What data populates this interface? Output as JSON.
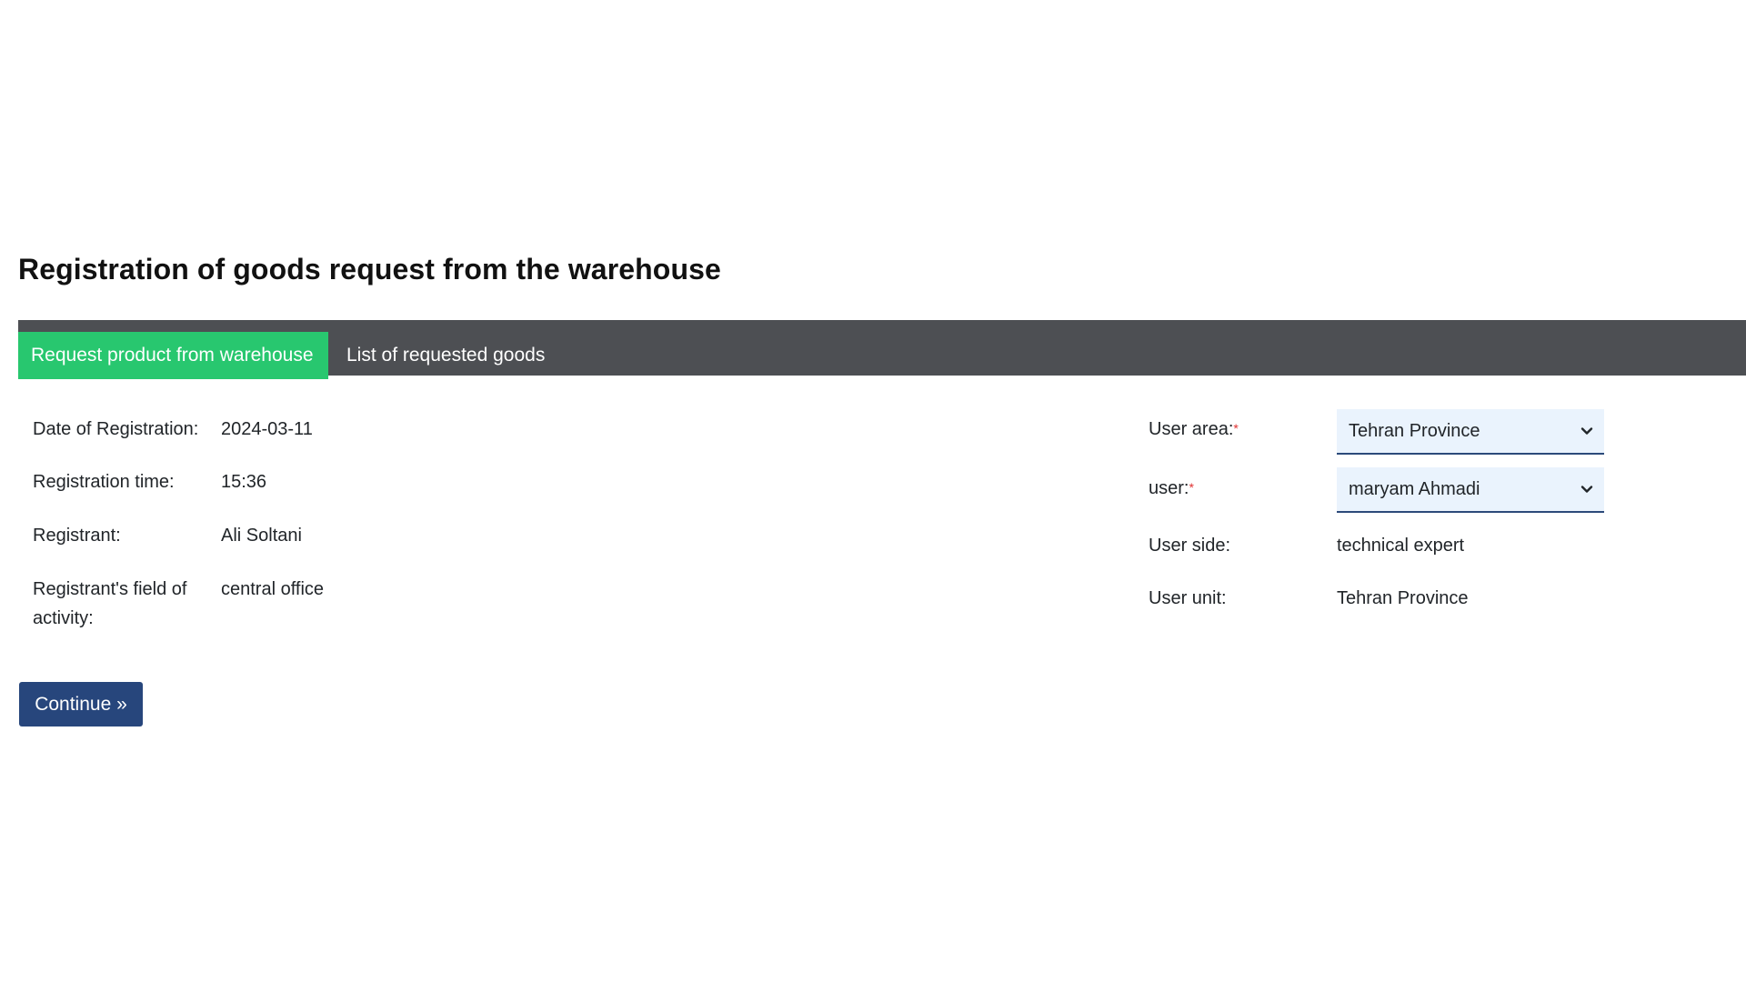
{
  "page_title": "Registration of goods request from the warehouse",
  "tabs": [
    {
      "label": "Request product from warehouse",
      "active": true
    },
    {
      "label": "List of requested goods",
      "active": false
    }
  ],
  "left_fields": {
    "date": {
      "label": "Date of Registration:",
      "value": "2024-03-11"
    },
    "time": {
      "label": "Registration time:",
      "value": "15:36"
    },
    "registrant": {
      "label": "Registrant:",
      "value": "Ali Soltani"
    },
    "field_of_activity": {
      "label_line1": "Registrant's field of",
      "label_line2": "activity:",
      "value": "central office"
    }
  },
  "right_fields": {
    "user_area": {
      "label": "User area:",
      "required_mark": "*",
      "selected": "Tehran Province"
    },
    "user": {
      "label": "user:",
      "required_mark": "*",
      "selected": "maryam Ahmadi"
    },
    "user_side": {
      "label": "User side:",
      "value": "technical expert"
    },
    "user_unit": {
      "label": "User unit:",
      "value": "Tehran Province"
    }
  },
  "continue_button": {
    "label": "Continue »"
  },
  "colors": {
    "tab_bar": "#4d4f53",
    "active_tab": "#28c76f",
    "button": "#27467c",
    "select_bg": "#eaf3fd",
    "required": "#e03131"
  },
  "icons": {
    "select_arrow": "chevron-down-icon"
  }
}
